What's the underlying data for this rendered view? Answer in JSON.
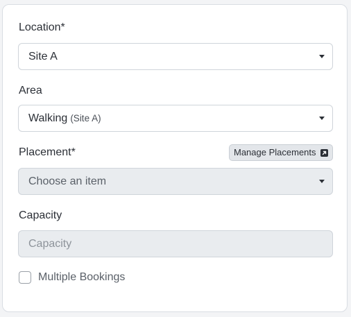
{
  "form": {
    "location": {
      "label": "Location*",
      "value": "Site A"
    },
    "area": {
      "label": "Area",
      "value": "Walking",
      "sub": "(Site A)"
    },
    "placement": {
      "label": "Placement*",
      "manage_button": "Manage Placements",
      "manage_icon": "external-link-icon",
      "value": "Choose an item"
    },
    "capacity": {
      "label": "Capacity",
      "placeholder": "Capacity"
    },
    "multiple_bookings": {
      "label": "Multiple Bookings",
      "checked": false
    }
  }
}
